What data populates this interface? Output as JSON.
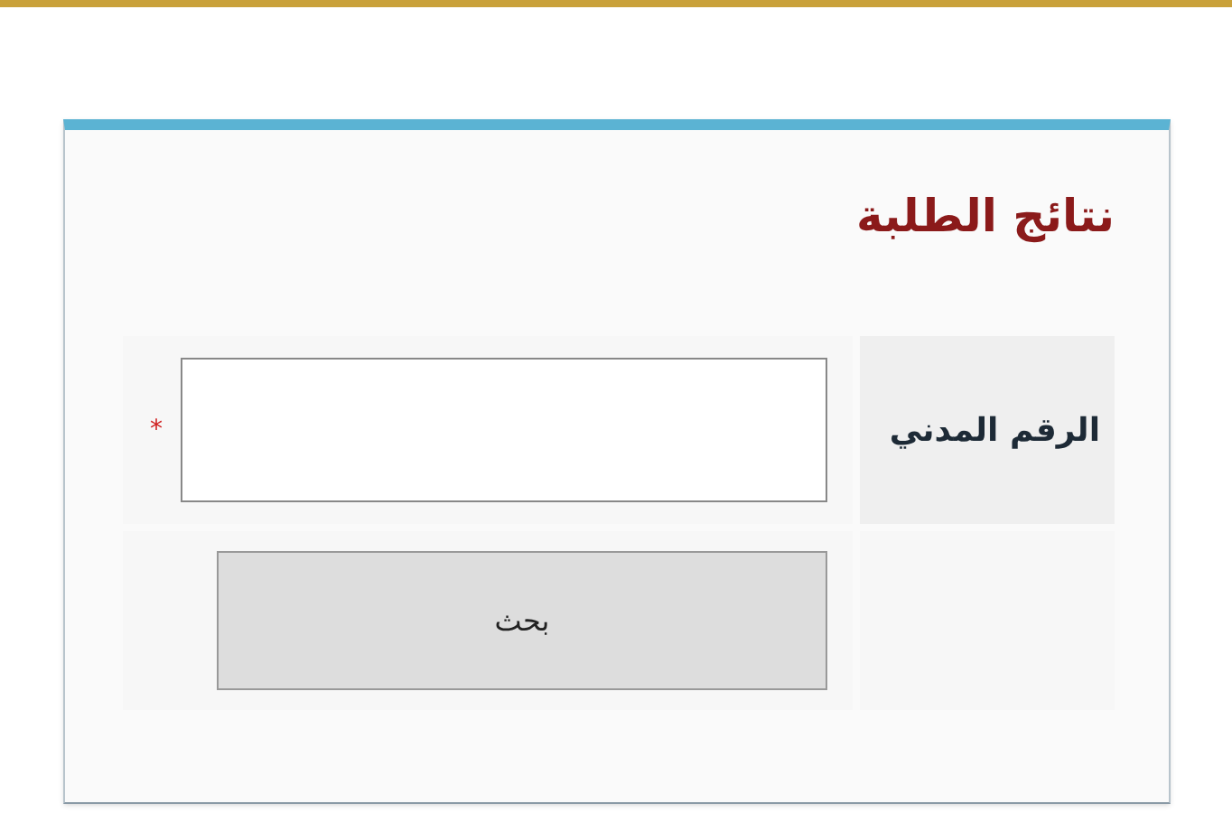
{
  "title": "نتائج الطلبة",
  "form": {
    "field_label": "الرقم المدني",
    "required_mark": "*",
    "search_button": "بحث"
  }
}
